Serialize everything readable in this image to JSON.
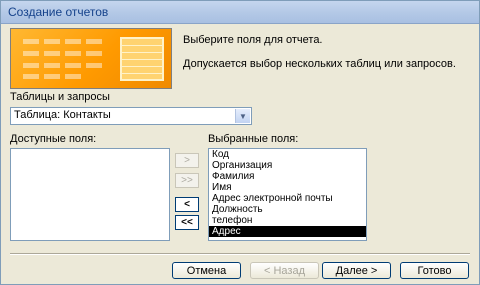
{
  "window": {
    "title": "Создание отчетов"
  },
  "header": {
    "line1": "Выберите поля для отчета.",
    "line2": "Допускается выбор нескольких таблиц или запросов."
  },
  "source": {
    "label": "Таблицы и запросы",
    "selected": "Таблица: Контакты"
  },
  "available": {
    "label": "Доступные поля:",
    "items": []
  },
  "selected_fields": {
    "label": "Выбранные поля:",
    "items": [
      "Код",
      "Организация",
      "Фамилия",
      "Имя",
      "Адрес электронной почты",
      "Должность",
      "телефон",
      "Адрес"
    ],
    "highlighted": "Адрес"
  },
  "move_buttons": {
    "add_one": ">",
    "add_all": ">>",
    "remove_one": "<",
    "remove_all": "<<"
  },
  "footer": {
    "cancel": "Отмена",
    "back": "< Назад",
    "next": "Далее >",
    "finish": "Готово"
  }
}
